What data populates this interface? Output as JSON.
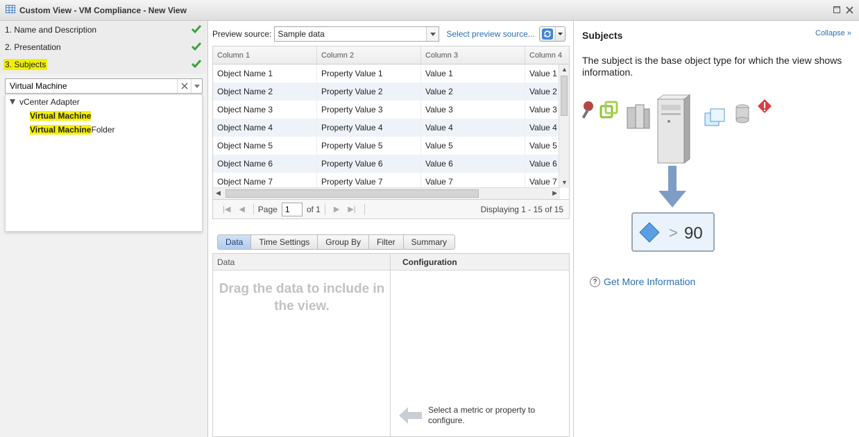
{
  "window": {
    "title": "Custom View - VM Compliance - New View"
  },
  "steps": [
    {
      "label": "1. Name and Description"
    },
    {
      "label": "2. Presentation"
    },
    {
      "label": "3. Subjects"
    }
  ],
  "search": {
    "value": "Virtual Machine"
  },
  "tree": {
    "root": "vCenter Adapter",
    "children": [
      {
        "match": "Virtual Machine",
        "rest": ""
      },
      {
        "match": "Virtual Machine",
        "rest": " Folder"
      }
    ]
  },
  "preview": {
    "label": "Preview source:",
    "source": "Sample data",
    "select_link": "Select preview source..."
  },
  "grid": {
    "columns": [
      "Column 1",
      "Column 2",
      "Column 3",
      "Column 4"
    ],
    "rows": [
      [
        "Object Name 1",
        "Property Value 1",
        "Value 1",
        "Value 1"
      ],
      [
        "Object Name 2",
        "Property Value 2",
        "Value 2",
        "Value 2"
      ],
      [
        "Object Name 3",
        "Property Value 3",
        "Value 3",
        "Value 3"
      ],
      [
        "Object Name 4",
        "Property Value 4",
        "Value 4",
        "Value 4"
      ],
      [
        "Object Name 5",
        "Property Value 5",
        "Value 5",
        "Value 5"
      ],
      [
        "Object Name 6",
        "Property Value 6",
        "Value 6",
        "Value 6"
      ],
      [
        "Object Name 7",
        "Property Value 7",
        "Value 7",
        "Value 7"
      ]
    ]
  },
  "pager": {
    "page_label": "Page",
    "page": "1",
    "of": "of 1",
    "displaying": "Displaying 1 - 15 of 15"
  },
  "tabs": [
    "Data",
    "Time Settings",
    "Group By",
    "Filter",
    "Summary"
  ],
  "data_panel": {
    "data_header": "Data",
    "config_header": "Configuration",
    "drag_msg": "Drag the data to include in the view.",
    "select_msg": "Select a metric or property to configure."
  },
  "subjects_panel": {
    "title": "Subjects",
    "collapse": "Collapse",
    "description": "The subject is the base object type for which the view shows information.",
    "badge_op": ">",
    "badge_value": "90",
    "more_link": "Get More Information"
  },
  "colors": {
    "accent": "#2a6fb4",
    "highlight": "#f7f000",
    "check": "#3aa33a"
  }
}
